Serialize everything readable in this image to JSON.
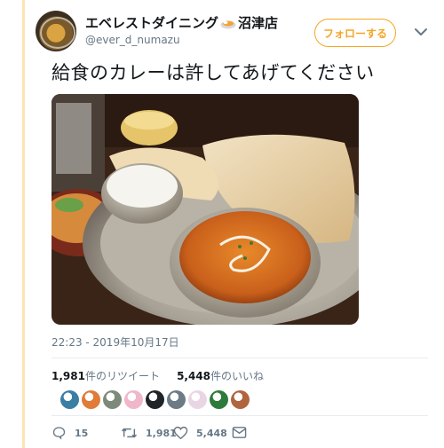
{
  "account": {
    "name": "エベレストダイニング",
    "name_suffix": "沼津店",
    "handle": "@ever_d_numazu"
  },
  "follow_button": {
    "label": "フォローする"
  },
  "tweet": {
    "text": "給食のカレーは許してあげてください",
    "timestamp": "22:23 - 2019年10月17日"
  },
  "stats": {
    "retweets_count": "1,981",
    "retweets_label": "件のリツイート",
    "likes_count": "5,448",
    "likes_label": "件のいいね"
  },
  "liker_avatars": [
    "#3a7fa3",
    "#e07b39",
    "#7d8a7a",
    "#f0b6c9",
    "#1f2429",
    "#6d7b86",
    "#e9d6e4",
    "#2e7a3a",
    "#b0653f"
  ],
  "actions": {
    "reply_count": "15",
    "retweet_count": "1,981",
    "like_count": "5,448"
  },
  "colors": {
    "accent": "#f5a623",
    "muted": "#657786"
  }
}
